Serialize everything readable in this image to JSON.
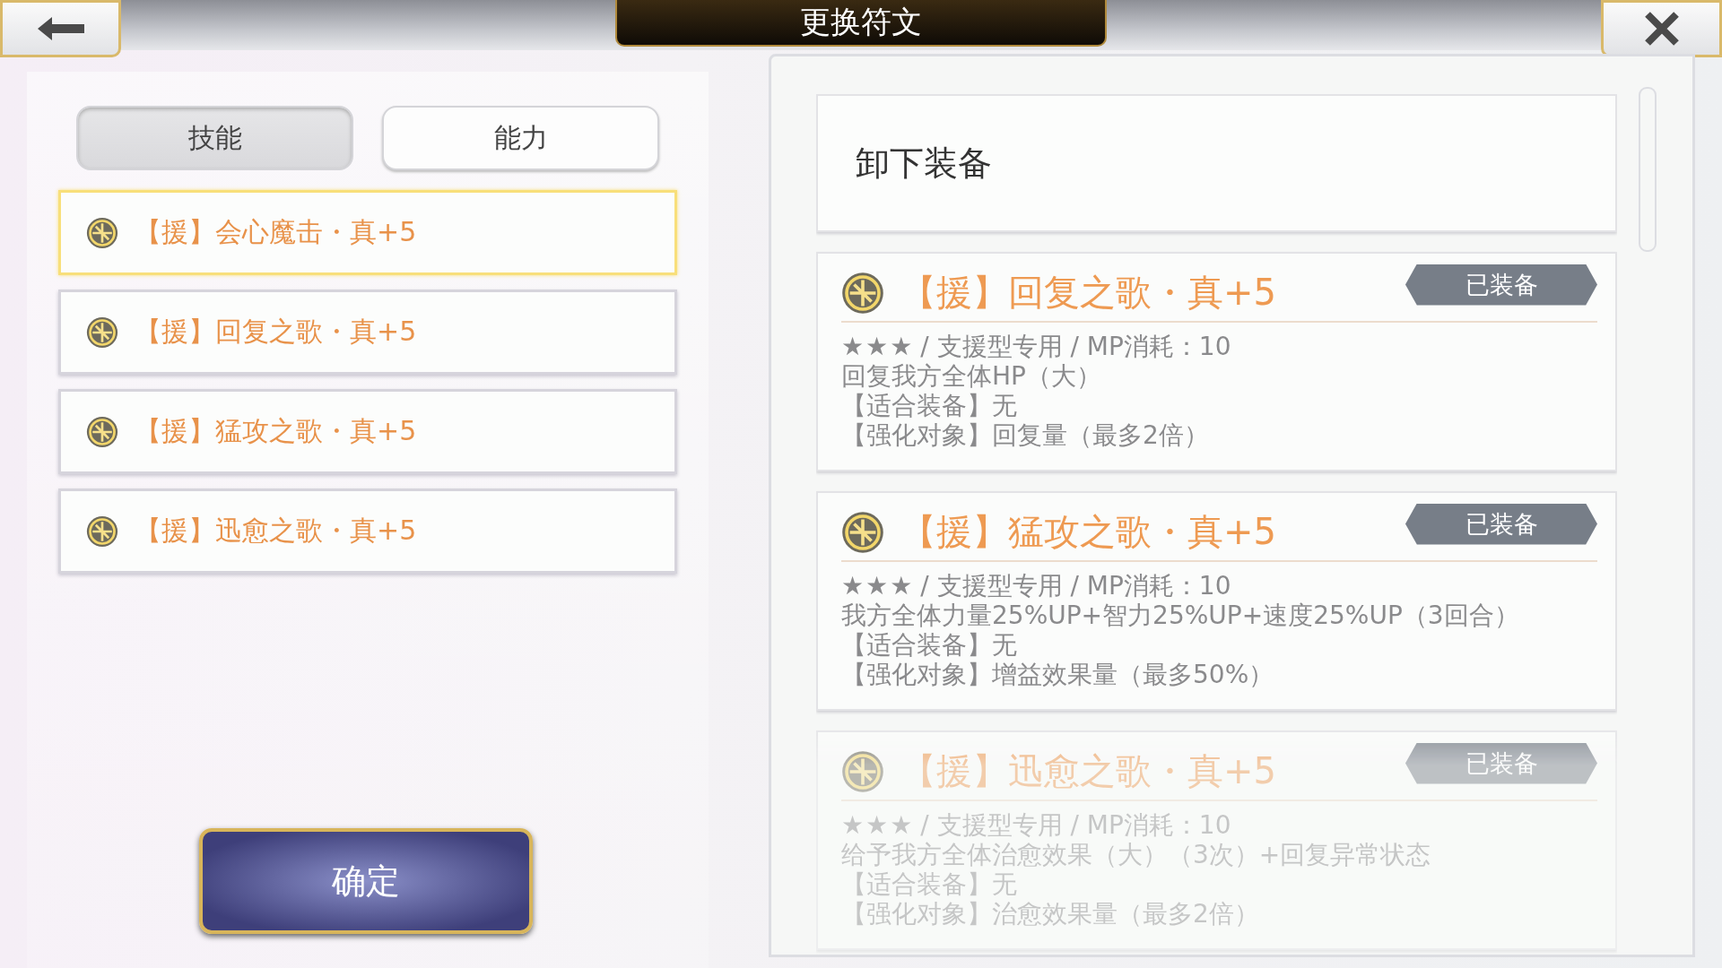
{
  "window": {
    "title": "更换符文"
  },
  "tabs": [
    {
      "label": "技能",
      "selected": true
    },
    {
      "label": "能力",
      "selected": false
    }
  ],
  "rune_list": [
    {
      "name": "【援】会心魔击・真+5",
      "selected": true
    },
    {
      "name": "【援】回复之歌・真+5",
      "selected": false
    },
    {
      "name": "【援】猛攻之歌・真+5",
      "selected": false
    },
    {
      "name": "【援】迅愈之歌・真+5",
      "selected": false
    }
  ],
  "confirm_button": "确定",
  "unequip_option": "卸下装备",
  "rune_details": [
    {
      "name": "【援】回复之歌・真+5",
      "badge": "已装备",
      "stars": 3,
      "info": " / 支援型专用 / MP消耗：10",
      "lines": [
        "回复我方全体HP（大）",
        "【适合装备】无",
        "【强化对象】回复量（最多2倍）"
      ]
    },
    {
      "name": "【援】猛攻之歌・真+5",
      "badge": "已装备",
      "stars": 3,
      "info": " / 支援型专用 / MP消耗：10",
      "lines": [
        "我方全体力量25%UP+智力25%UP+速度25%UP（3回合）",
        "【适合装备】无",
        "【强化对象】增益效果量（最多50%）"
      ]
    },
    {
      "name": "【援】迅愈之歌・真+5",
      "badge": "已装备",
      "stars": 3,
      "info": " / 支援型专用 / MP消耗：10",
      "lines": [
        "给予我方全体治愈效果（大）（3次）+回复异常状态",
        "【适合装备】无",
        "【强化对象】治愈效果量（最多2倍）"
      ]
    }
  ]
}
